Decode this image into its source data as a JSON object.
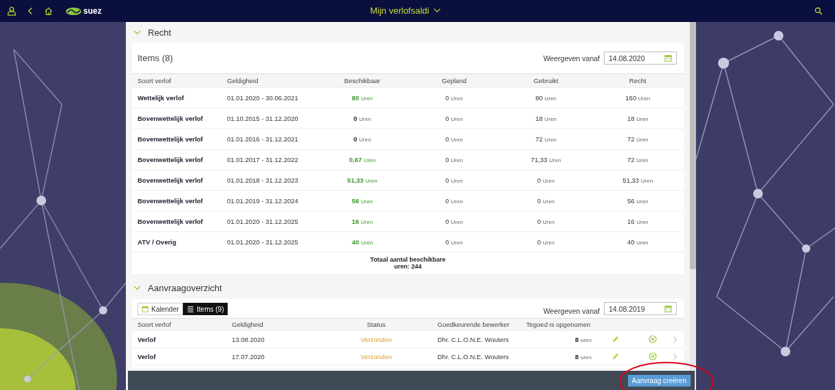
{
  "topbar": {
    "logo_text": "suez",
    "title": "Mijn verlofsaldi"
  },
  "recht": {
    "heading": "Recht",
    "expanded": true,
    "items_title": "Items (8)",
    "filter_label": "Weergeven vanaf",
    "filter_value": "14.08.2020",
    "columns": [
      "Soort verlof",
      "Geldigheid",
      "Beschikbaar",
      "Gepland",
      "Gebruikt",
      "Recht"
    ],
    "rows": [
      {
        "type": "Wettelijk verlof",
        "period": "01.01.2020 - 30.06.2021",
        "available": "80",
        "available_positive": true,
        "available_unit": "Uren",
        "planned": "0",
        "planned_unit": "Uren",
        "used": "80",
        "used_unit": "Uren",
        "entitled": "160",
        "entitled_unit": "Uren"
      },
      {
        "type": "Bovenwettelijk verlof",
        "period": "01.10.2015 - 31.12.2020",
        "available": "0",
        "available_positive": false,
        "available_unit": "Uren",
        "planned": "0",
        "planned_unit": "Uren",
        "used": "18",
        "used_unit": "Uren",
        "entitled": "18",
        "entitled_unit": "Uren"
      },
      {
        "type": "Bovenwettelijk verlof",
        "period": "01.01.2016 - 31.12.2021",
        "available": "0",
        "available_positive": false,
        "available_unit": "Uren",
        "planned": "0",
        "planned_unit": "Uren",
        "used": "72",
        "used_unit": "Uren",
        "entitled": "72",
        "entitled_unit": "Uren"
      },
      {
        "type": "Bovenwettelijk verlof",
        "period": "01.01.2017 - 31.12.2022",
        "available": "0,67",
        "available_positive": true,
        "available_unit": "Uren",
        "planned": "0",
        "planned_unit": "Uren",
        "used": "71,33",
        "used_unit": "Uren",
        "entitled": "72",
        "entitled_unit": "Uren"
      },
      {
        "type": "Bovenwettelijk verlof",
        "period": "01.01.2018 - 31.12.2023",
        "available": "51,33",
        "available_positive": true,
        "available_unit": "Uren",
        "planned": "0",
        "planned_unit": "Uren",
        "used": "0",
        "used_unit": "Uren",
        "entitled": "51,33",
        "entitled_unit": "Uren"
      },
      {
        "type": "Bovenwettelijk verlof",
        "period": "01.01.2019 - 31.12.2024",
        "available": "56",
        "available_positive": true,
        "available_unit": "Uren",
        "planned": "0",
        "planned_unit": "Uren",
        "used": "0",
        "used_unit": "Uren",
        "entitled": "56",
        "entitled_unit": "Uren"
      },
      {
        "type": "Bovenwettelijk verlof",
        "period": "01.01.2020 - 31.12.2025",
        "available": "16",
        "available_positive": true,
        "available_unit": "Uren",
        "planned": "0",
        "planned_unit": "Uren",
        "used": "0",
        "used_unit": "Uren",
        "entitled": "16",
        "entitled_unit": "Uren"
      },
      {
        "type": "ATV / Overig",
        "period": "01.01.2020 - 31.12.2025",
        "available": "40",
        "available_positive": true,
        "available_unit": "Uren",
        "planned": "0",
        "planned_unit": "Uren",
        "used": "0",
        "used_unit": "Uren",
        "entitled": "40",
        "entitled_unit": "Uren"
      }
    ],
    "total_line1": "Totaal aantal beschikbare",
    "total_line2": "uren: 244"
  },
  "aanvraag": {
    "heading": "Aanvraagoverzicht",
    "expanded": true,
    "tabs": [
      {
        "label": "Kalender",
        "selected": false,
        "kind": "calendar"
      },
      {
        "label": "Items (9)",
        "selected": true,
        "kind": "list"
      }
    ],
    "filter_label": "Weergeven vanaf",
    "filter_value": "14.08.2019",
    "columns": [
      "Soort verlof",
      "Geldigheid",
      "Status",
      "Goedkeurende bewerker",
      "Tegoed is opgenomen"
    ],
    "rows": [
      {
        "type": "Verlof",
        "date": "13.08.2020",
        "status": "Verzonden",
        "approver": "Dhr. C.L.O.N.E. Wouters",
        "amount": "8",
        "unit": "uren"
      },
      {
        "type": "Verlof",
        "date": "17.07.2020",
        "status": "Verzonden",
        "approver": "Dhr. C.L.O.N.E. Wouters",
        "amount": "8",
        "unit": "uren"
      }
    ]
  },
  "footer": {
    "button": "Aanvraag creëren"
  }
}
